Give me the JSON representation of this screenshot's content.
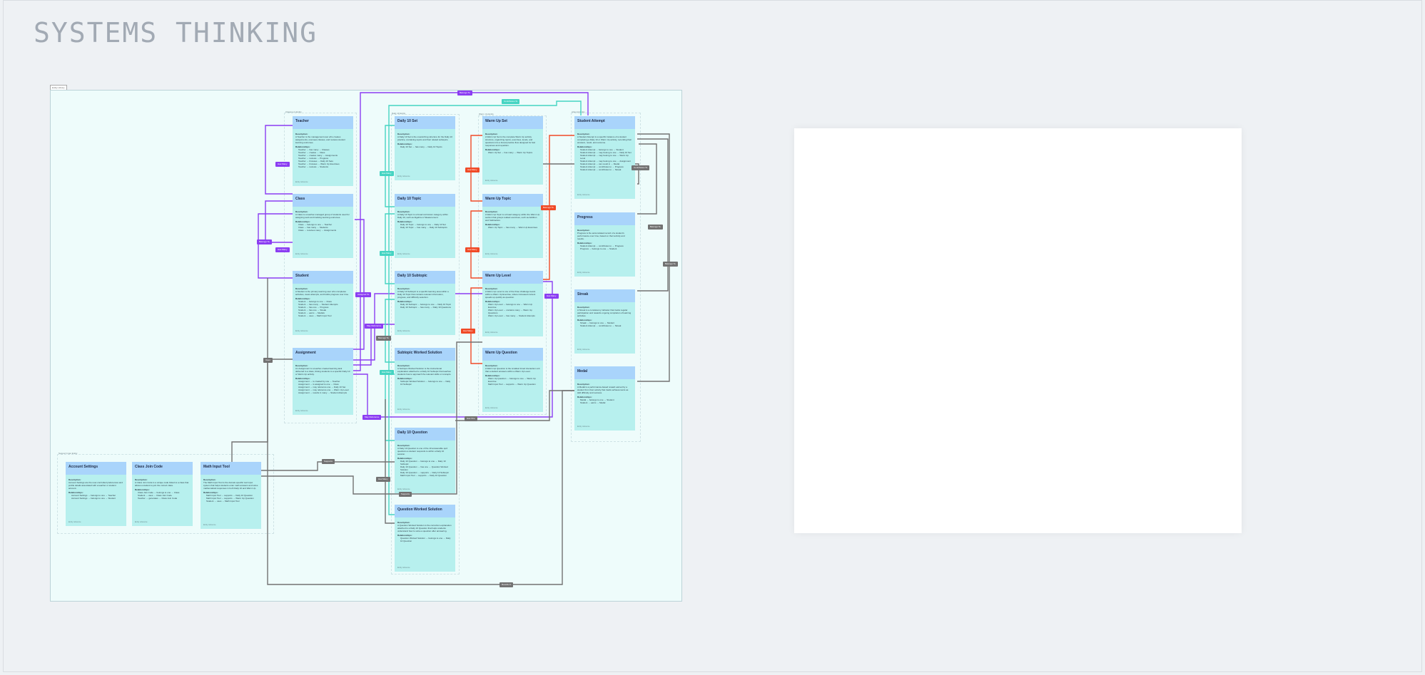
{
  "page": {
    "title": "SYSTEMS THINKING"
  },
  "board": {
    "tag": "Entity Library"
  },
  "groups": [
    {
      "label": "Classroom Entity"
    },
    {
      "label": "Daily 10 Entity"
    },
    {
      "label": "Warm Up Entity"
    },
    {
      "label": "Attempt Entity"
    },
    {
      "label": "Support Input Entity"
    }
  ],
  "cards": [
    {
      "title": "Teacher",
      "desc": "A Teacher is the management user who creates assignments, oversees classes, and reviews student learning outcomes.",
      "rels": [
        "Teacher → has many → Classes",
        "Teacher → creates → Class",
        "Teacher → creates many → Assignments",
        "Teacher → reviews → Progress",
        "Teacher → browses → Daily 10 Sets",
        "Teacher → browses → Warm Up Exercises",
        "Teacher → reviews → Students"
      ]
    },
    {
      "title": "Class",
      "desc": "A Class is a teacher-managed group of students used for assigning work and tracking learning outcomes.",
      "rels": [
        "Class → belongs to one → Teacher",
        "Class → has many → Students",
        "Class → receives many → Assignments"
      ]
    },
    {
      "title": "Student",
      "desc": "A Student is the primary learning user who completes activities, views attempts, and builds progress over time.",
      "rels": [
        "Student → belongs to one → Class",
        "Student → has many → Student Attempts",
        "Student → has one → Progress",
        "Student → has one → Streak",
        "Student → earns → Medals",
        "Student → uses → Math Input Tool"
      ]
    },
    {
      "title": "Assignment",
      "desc": "An Assignment is a teacher-created learning task delivered to a class, linking students to a specific Daily 10 or Warm Up activity.",
      "rels": [
        "Assignment → is created by one → Teacher",
        "Assignment → is assigned to one → Class",
        "Assignment → may reference one → Daily 10 Set",
        "Assignment → may reference one → Warm Up Level",
        "Assignment → results in many → Student Attempts"
      ]
    },
    {
      "title": "Daily 10 Set",
      "desc": "A Daily 10 Set is the overarching structure for the Daily 10 practice, containing topics and their related subtopics.",
      "rels": [
        "Daily 10 Set → has many → Daily 10 Topics"
      ]
    },
    {
      "title": "Daily 10 Topic",
      "desc": "A Daily 10 Topic is a broad curriculum category within Daily 10, such as Algebra or Measurement.",
      "rels": [
        "Daily 10 Topic → belongs to one → Daily 10 Set",
        "Daily 10 Topic → has many → Daily 10 Subtopics"
      ]
    },
    {
      "title": "Daily 10 Subtopic",
      "desc": "A Daily 10 Subtopic is a specific learning area within a Daily 10 Topic that contains relevant information, progress, and difficulty selection.",
      "rels": [
        "Daily 10 Subtopic → belongs to one → Daily 10 Topic",
        "Daily 10 Subtopic → has many → Daily 10 Questions"
      ]
    },
    {
      "title": "Subtopic Worked Solution",
      "desc": "A Subtopic Worked Solution is the instructional explanation attached to a Daily 10 Subtopic that teaches students how to approach the relevant skills or concepts.",
      "rels": [
        "Subtopic Worked Solution → belongs to one → Daily 10 Subtopic"
      ]
    },
    {
      "title": "Daily 10 Question",
      "desc": "A Daily 10 Question is one of the 10 answerable quiz questions a student responds to within a Daily 10 session.",
      "rels": [
        "Daily 10 Question → belongs to one → Daily 10 Subtopic",
        "Daily 10 Question → has one → Question Worked Solution",
        "Daily 10 Question → supports → Daily 10 Subtopic",
        "Math Input Tool → supports → Daily 10 Question"
      ]
    },
    {
      "title": "Question Worked Solution",
      "desc": "A Question Worked Solution is the correction explanation attached to a Daily 10 Question that helps students understand how to solve a question after answering.",
      "rels": [
        "Question Worked Solution → belongs to one → Daily 10 Question"
      ]
    },
    {
      "title": "Warm Up Set",
      "desc": "A Warm Up Set is the complete Warm Up activity structure, organizing topics, exercises, levels, and questions into a broad practice flow designed for fast responses and repetition.",
      "rels": [
        "Warm Up Set → has many → Warm Up Topics"
      ]
    },
    {
      "title": "Warm Up Topic",
      "desc": "A Warm Up Topic is a broad category within the Warm Up section that groups related exercises, such as Addition and Subtraction.",
      "rels": [
        "Warm Up Topic → has many → Warm Up Exercises"
      ]
    },
    {
      "title": "Warm Up Level",
      "desc": "A Warm Up Level is one of the three challenge levels within a Warm Up Exercise, where increased content speeds up quickly as question.",
      "rels": [
        "Warm Up Level → belongs to one → Warm Up Exercise",
        "Warm Up Level → contains many → Warm Up Questions",
        "Warm Up Level → has many → Student Attempts"
      ]
    },
    {
      "title": "Warm Up Question",
      "desc": "A Warm Up Question is the smallest timed interaction unit that a student answers within a Warm Up Level.",
      "rels": [
        "Warm Up Question → belongs to one → Warm Up Exercise",
        "Math Input Tool → supports → Warm Up Question"
      ]
    },
    {
      "title": "Student Attempt",
      "desc": "A Student Attempt is a specific instance of a student completing a Daily 10 or Warm Up activity, recording their answers, result, and outcome.",
      "rels": [
        "Student Attempt → belongs to one → Student",
        "Student Attempt → may belong to one → Daily 10 Set",
        "Student Attempt → may belong to one → Warm Up Level",
        "Student Attempt → may belong to one → Assignment",
        "Student Attempt → can result in → Medal",
        "Student Attempt → contributes to → Progress",
        "Student Attempt → contributes to → Streak"
      ]
    },
    {
      "title": "Progress",
      "desc": "Progress is the accumulated record of a student's performance over time, based on their activity and results.",
      "rels": [
        "Student Attempt → contributes to → Progress",
        "Progress → belongs to one → Student"
      ]
    },
    {
      "title": "Streak",
      "desc": "A Streak is a consistency indicator that tracks regular participation and rewards ongoing completion of learning activities.",
      "rels": [
        "Streak → belongs to one → Student",
        "Student Attempt → contributes to → Streak"
      ]
    },
    {
      "title": "Medal",
      "desc": "A Medal is a performance-based reward earned by a student from their activity that tracks achievements as skill difficulty and success.",
      "rels": [
        "Medal → belongs to one → Student",
        "Student → earns → Medal"
      ]
    },
    {
      "title": "Account Settings",
      "desc": "Account Settings are the user-controlled preferences and profile details associated with a teacher or student account.",
      "rels": [
        "Account Settings → belongs to one → Teacher",
        "Account Settings → belongs to one → Student"
      ]
    },
    {
      "title": "Class Join Code",
      "desc": "A Class Join Code is a unique code linked to a class that allows a student to join the correct class.",
      "rels": [
        "Class Join Code → belongs to one → Class",
        "Student → uses → Class Join Code",
        "Teacher → generates → Class Join Code"
      ]
    },
    {
      "title": "Math Input Tool",
      "desc": "The Math Input Tool is the domain-specific tool input system that helps students enter math answers and solve mathematical responses in both Daily 10 and Warm Up.",
      "rels": [
        "Math Input Tool → supports → Daily 10 Question",
        "Math Input Tool → supports → Warm Up Question",
        "Student → uses → Math Input Tool"
      ]
    }
  ],
  "labels": {
    "description": "Description:",
    "relationships": "Relationships:",
    "foot": "Entity reference"
  },
  "badges": [
    "Belongs To",
    "Has Many",
    "Has Many",
    "Has Many",
    "Contributes To",
    "Has Many",
    "Has Many",
    "Has Many",
    "Has Many",
    "Has Many",
    "Has Many",
    "Has Many",
    "Belongs To",
    "Assigned To",
    "May Reference",
    "May Reference",
    "Belongs To",
    "Contributes To",
    "Belongs To",
    "Results In",
    "Supports",
    "Belongs To",
    "Has One",
    "Supports",
    "Uses",
    "Belongs To",
    "Belongs To",
    "Has Many"
  ],
  "colors": {
    "purple": "#8b3df2",
    "red": "#f04a27",
    "teal": "#45d4c2",
    "gray": "#727272",
    "card_head": "#a9d4fb",
    "card_body": "#b7f0ee"
  }
}
